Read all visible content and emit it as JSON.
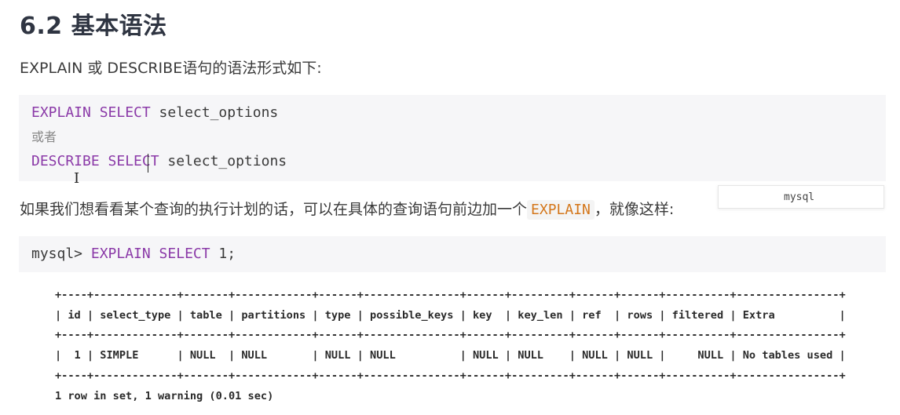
{
  "heading": "6.2 基本语法",
  "intro": "EXPLAIN 或 DESCRIBE语句的语法形式如下:",
  "syntax_block": {
    "line1_keywords": "EXPLAIN SELECT",
    "line1_rest": " select_options",
    "line2": "或者",
    "line3_keywords": "DESCRIBE SELECT",
    "line3_rest": " select_options"
  },
  "para2": {
    "before": "如果我们想看看某个查询的执行计划的话，可以在具体的查询语句前边加一个",
    "code": "EXPLAIN",
    "after": "，就像这样:"
  },
  "language_tag": "mysql",
  "example_block": {
    "prompt": "mysql> ",
    "keywords": "EXPLAIN SELECT",
    "rest": " 1;"
  },
  "result_table": {
    "border": "+----+-------------+-------+------------+------+---------------+------+---------+------+------+----------+----------------+",
    "header": "| id | select_type | table | partitions | type | possible_keys | key  | key_len | ref  | rows | filtered | Extra          |",
    "row": "|  1 | SIMPLE      | NULL  | NULL       | NULL | NULL          | NULL | NULL    | NULL | NULL |     NULL | No tables used |",
    "footer": "1 row in set, 1 warning (0.01 sec)"
  },
  "colors": {
    "keyword": "#8b3aa8",
    "inline_code": "#d4761a",
    "code_background": "#f6f6f8"
  }
}
